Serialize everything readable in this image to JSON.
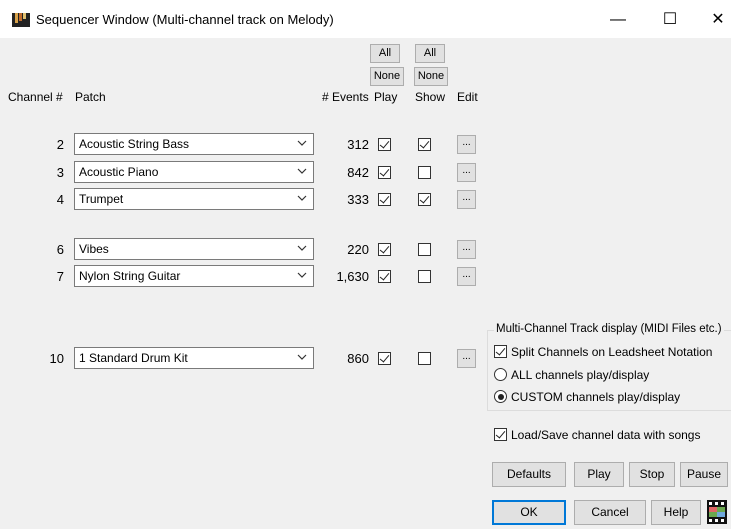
{
  "window": {
    "title": "Sequencer Window  (Multi-channel track on Melody)",
    "minimize_glyph": "—",
    "maximize_glyph": "☐",
    "close_glyph": "✕"
  },
  "header_buttons": {
    "play_all": "All",
    "show_all": "All",
    "play_none": "None",
    "show_none": "None"
  },
  "columns": {
    "channel": "Channel #",
    "patch": "Patch",
    "events": "# Events",
    "play": "Play",
    "show": "Show",
    "edit": "Edit"
  },
  "rows": [
    {
      "channel": "2",
      "patch": "Acoustic String Bass",
      "events": "312",
      "play": true,
      "show": true,
      "edit": "..."
    },
    {
      "channel": "3",
      "patch": "Acoustic Piano",
      "events": "842",
      "play": true,
      "show": false,
      "edit": "..."
    },
    {
      "channel": "4",
      "patch": "Trumpet",
      "events": "333",
      "play": true,
      "show": true,
      "edit": "..."
    },
    {
      "channel": "6",
      "patch": "Vibes",
      "events": "220",
      "play": true,
      "show": false,
      "edit": "..."
    },
    {
      "channel": "7",
      "patch": "Nylon String Guitar",
      "events": "1,630",
      "play": true,
      "show": false,
      "edit": "..."
    },
    {
      "channel": "10",
      "patch": "1 Standard Drum Kit",
      "events": "860",
      "play": true,
      "show": false,
      "edit": "..."
    }
  ],
  "display_group": {
    "legend": "Multi-Channel Track display (MIDI Files etc.)",
    "split_channels": {
      "label": "Split Channels on Leadsheet Notation",
      "checked": true
    },
    "all_channels": {
      "label": "ALL channels play/display",
      "selected": false
    },
    "custom_channels": {
      "label": "CUSTOM channels play/display",
      "selected": true
    }
  },
  "load_save": {
    "label": "Load/Save channel data with songs",
    "checked": true
  },
  "buttons": {
    "defaults": "Defaults",
    "play": "Play",
    "stop": "Stop",
    "pause": "Pause",
    "ok": "OK",
    "cancel": "Cancel",
    "help": "Help"
  },
  "icons": {
    "app": "band-in-a-box-piano-icon",
    "dropdown": "chevron-down-icon",
    "video": "film-clapper-icon"
  },
  "colors": {
    "default_button_border": "#0078d7",
    "window_bg": "#f0f0f0"
  }
}
